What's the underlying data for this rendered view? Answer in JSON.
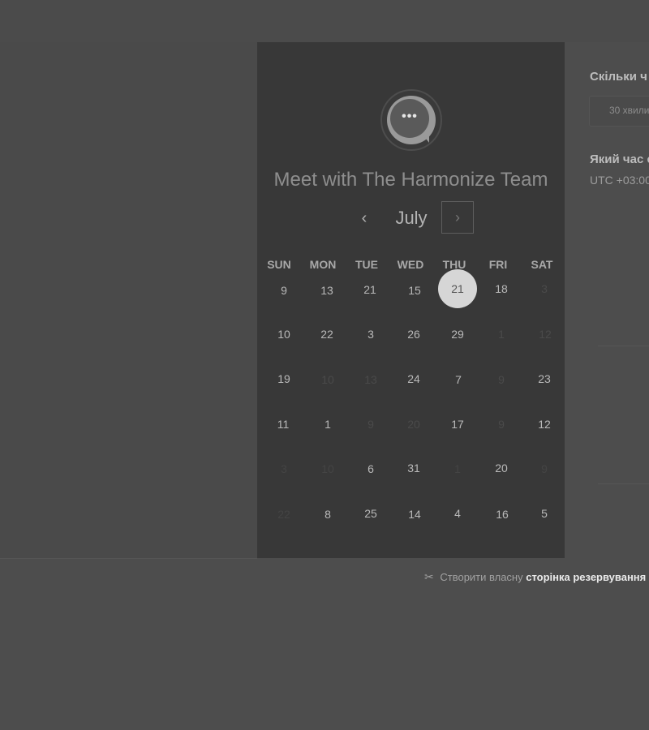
{
  "card": {
    "logo_text": "•••",
    "title": "Meet with The Harmonize Team",
    "month": "July",
    "prev_icon": "‹",
    "next_icon": "›"
  },
  "weekdays": [
    "SUN",
    "MON",
    "TUE",
    "WED",
    "THU",
    "FRI",
    "SAT"
  ],
  "days": [
    [
      "9",
      "13",
      "21",
      "15",
      "21",
      "18",
      "3"
    ],
    [
      "10",
      "22",
      "3",
      "26",
      "29",
      "1",
      "12"
    ],
    [
      "19",
      "10",
      "13",
      "24",
      "7",
      "9",
      "23"
    ],
    [
      "11",
      "1",
      "9",
      "20",
      "17",
      "9",
      "12"
    ],
    [
      "3",
      "10",
      "6",
      "31",
      "1",
      "20",
      "9"
    ],
    [
      "22",
      "8",
      "25",
      "14",
      "4",
      "16",
      "5"
    ]
  ],
  "selected_day": "21",
  "side": {
    "question_duration": "Скільки ч",
    "duration_value": "30 хвили",
    "question_time": "Який час с",
    "timezone": "UTC +03:00"
  },
  "footer": {
    "icon": "✂",
    "prefix": "Створити власну",
    "link": "сторінка резервування"
  }
}
